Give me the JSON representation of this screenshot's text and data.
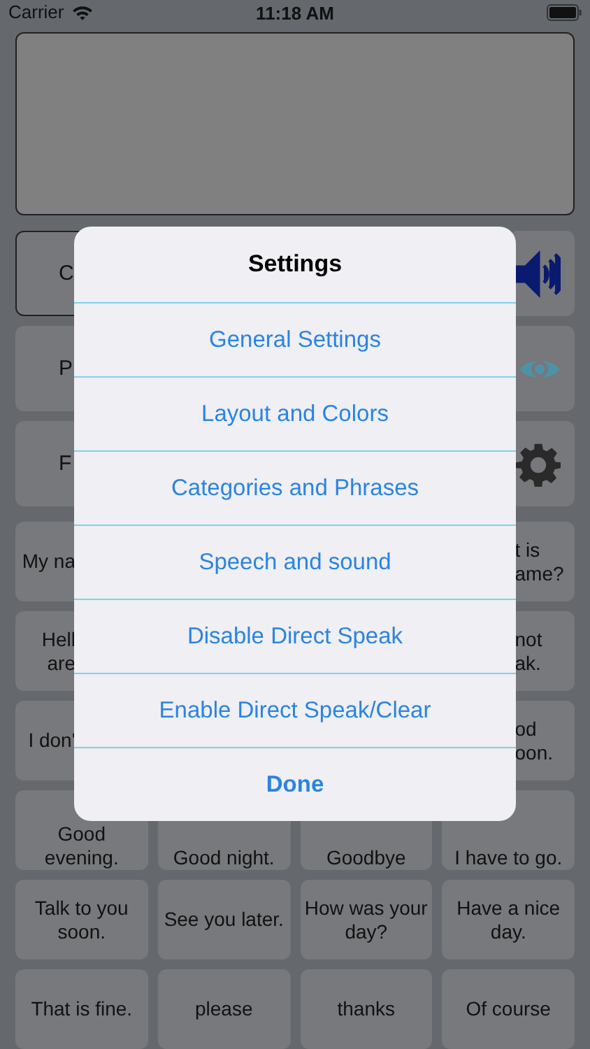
{
  "status_bar": {
    "carrier": "Carrier",
    "time": "11:18 AM"
  },
  "controls": [
    {
      "label": "C",
      "selected": true
    },
    {
      "label": "P",
      "selected": false
    },
    {
      "label": "F",
      "selected": false
    }
  ],
  "phrase_rows": [
    {
      "covered": true,
      "cells": [
        "My na",
        "t is\name?"
      ]
    },
    {
      "covered": true,
      "cells": [
        "Hell\nare",
        "not\nak."
      ]
    },
    {
      "covered": true,
      "cells": [
        "I don'",
        "od\noon."
      ]
    },
    {
      "covered": false,
      "cells": [
        "Good evening.",
        "Good night.",
        "Goodbye",
        "I have to go."
      ]
    },
    {
      "covered": false,
      "cells": [
        "Talk to you soon.",
        "See you later.",
        "How was your day?",
        "Have a nice day."
      ]
    },
    {
      "covered": false,
      "cells": [
        "That is fine.",
        "please",
        "thanks",
        "Of course"
      ]
    }
  ],
  "dialog": {
    "title": "Settings",
    "actions": [
      {
        "label": "General Settings",
        "kind": "normal"
      },
      {
        "label": "Layout and Colors",
        "kind": "normal"
      },
      {
        "label": "Categories and Phrases",
        "kind": "normal"
      },
      {
        "label": "Speech and sound",
        "kind": "normal"
      },
      {
        "label": "Disable Direct Speak",
        "kind": "normal"
      },
      {
        "label": "Enable Direct Speak/Clear",
        "kind": "normal"
      },
      {
        "label": "Done",
        "kind": "default"
      }
    ]
  }
}
